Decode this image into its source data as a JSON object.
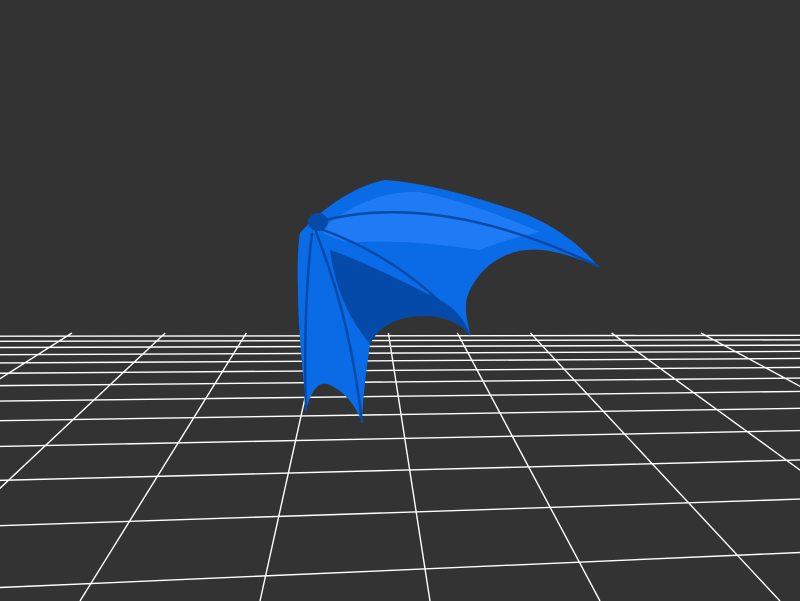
{
  "viewport": {
    "background_color": "#333333",
    "grid_color": "#ffffff",
    "model_color": "#0a6be6",
    "model_shadow_color": "#054aa8",
    "model_highlight_color": "#2b86ff",
    "model_name": "bat-wing-icon"
  }
}
